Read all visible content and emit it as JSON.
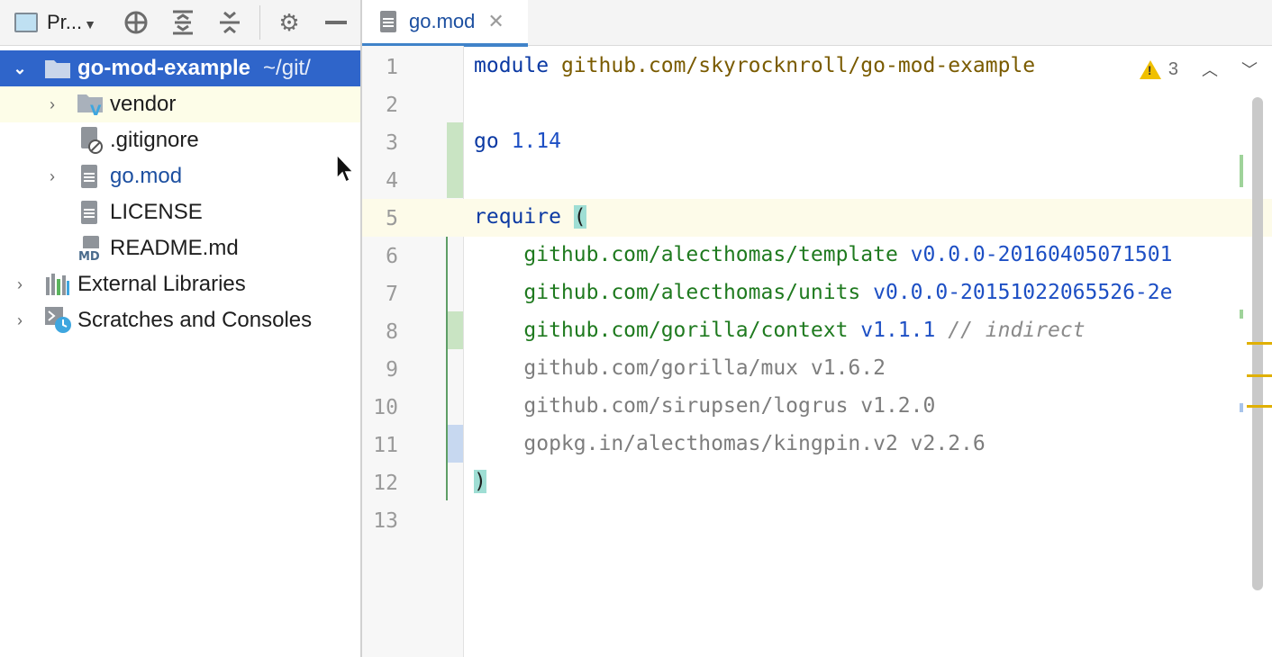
{
  "project_panel": {
    "title": "Pr...",
    "tree": {
      "root": {
        "name": "go-mod-example",
        "path": "~/git/"
      },
      "items": [
        {
          "label": "vendor",
          "icon": "vendor-folder-icon"
        },
        {
          "label": ".gitignore",
          "icon": "ignored-file-icon"
        },
        {
          "label": "go.mod",
          "icon": "text-file-icon"
        },
        {
          "label": "LICENSE",
          "icon": "text-file-icon"
        },
        {
          "label": "README.md",
          "icon": "markdown-file-icon"
        }
      ],
      "external_libraries": "External Libraries",
      "scratches": "Scratches and Consoles"
    }
  },
  "editor": {
    "tab": {
      "name": "go.mod",
      "close": "✕"
    },
    "inspection": {
      "warnings": "3"
    },
    "line_numbers": [
      "1",
      "2",
      "3",
      "4",
      "5",
      "6",
      "7",
      "8",
      "9",
      "10",
      "11",
      "12",
      "13"
    ],
    "lines": {
      "l1": {
        "kw": "module",
        "path": "github.com/skyrocknroll/go-mod-example"
      },
      "l3": {
        "kw": "go",
        "ver": "1.14"
      },
      "l5": {
        "kw": "require",
        "open": "("
      },
      "l6": {
        "mod": "github.com/alecthomas/template",
        "ver": "v0.0.0-20160405071501"
      },
      "l7": {
        "mod": "github.com/alecthomas/units",
        "ver": "v0.0.0-20151022065526-2e"
      },
      "l8": {
        "mod": "github.com/gorilla/context",
        "ver": "v1.1.1",
        "comment": "// indirect"
      },
      "l9": {
        "text": "github.com/gorilla/mux v1.6.2"
      },
      "l10": {
        "text": "github.com/sirupsen/logrus v1.2.0"
      },
      "l11": {
        "text": "gopkg.in/alecthomas/kingpin.v2 v2.2.6"
      },
      "l12": {
        "close": ")"
      }
    }
  },
  "colors": {
    "selection": "#2f65ca",
    "keyword": "#0b39a3",
    "module": "#1f7a1f",
    "version": "#1d4fc4",
    "warning": "#f0c000"
  }
}
